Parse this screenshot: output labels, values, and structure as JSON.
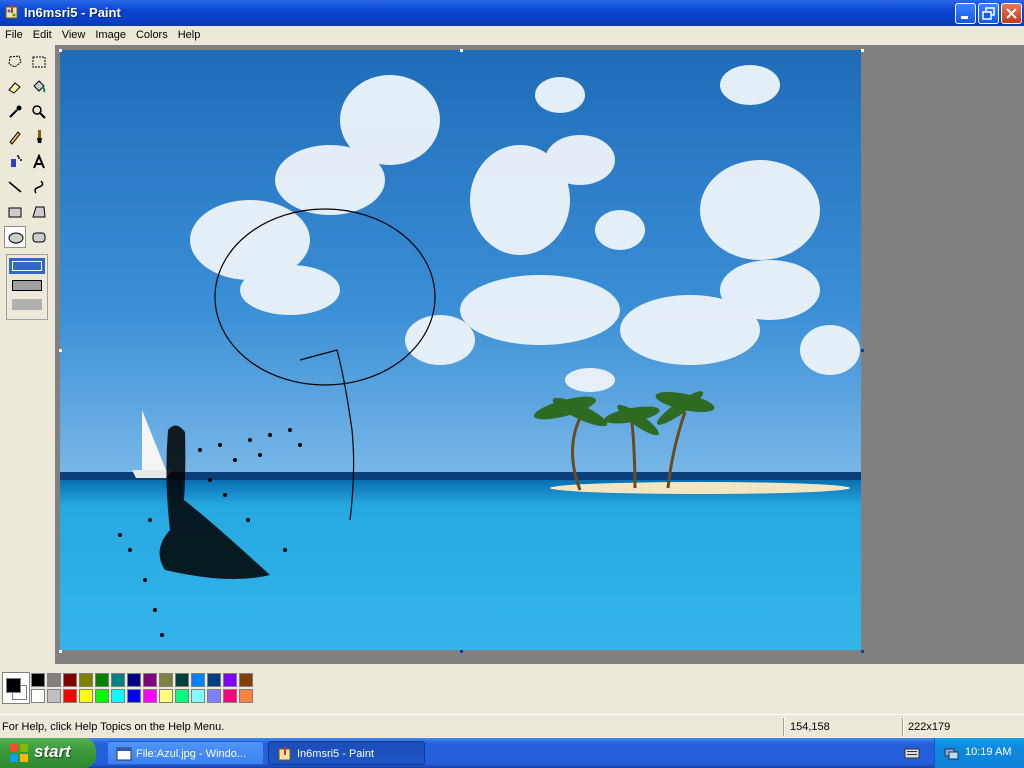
{
  "window": {
    "title": "In6msri5 - Paint"
  },
  "menu": [
    "File",
    "Edit",
    "View",
    "Image",
    "Colors",
    "Help"
  ],
  "tools": [
    "free-form-select",
    "select",
    "eraser",
    "fill-with-color",
    "pick-color",
    "magnifier",
    "pencil",
    "brush",
    "airbrush",
    "text",
    "line",
    "curve",
    "rectangle",
    "polygon",
    "ellipse",
    "rounded-rectangle"
  ],
  "active_tool": "ellipse",
  "palette": {
    "foreground": "#000000",
    "background": "#ffffff",
    "top_row": [
      "#000000",
      "#808080",
      "#800000",
      "#808000",
      "#008000",
      "#008080",
      "#000080",
      "#800080",
      "#808040",
      "#004040",
      "#0080ff",
      "#004080",
      "#8000ff",
      "#804000"
    ],
    "bottom_row": [
      "#ffffff",
      "#c0c0c0",
      "#ff0000",
      "#ffff00",
      "#00ff00",
      "#00ffff",
      "#0000ff",
      "#ff00ff",
      "#ffff80",
      "#00ff80",
      "#80ffff",
      "#8080ff",
      "#ff0080",
      "#ff8040"
    ]
  },
  "status": {
    "help_text": "For Help, click Help Topics on the Help Menu.",
    "cursor_position": "154,158",
    "selection_size": "222x179"
  },
  "taskbar": {
    "start_label": "start",
    "tasks": [
      {
        "label": "File:Azul.jpg - Windo...",
        "active": false
      },
      {
        "label": "In6msri5 - Paint",
        "active": true
      }
    ],
    "clock": "10:19 AM"
  }
}
